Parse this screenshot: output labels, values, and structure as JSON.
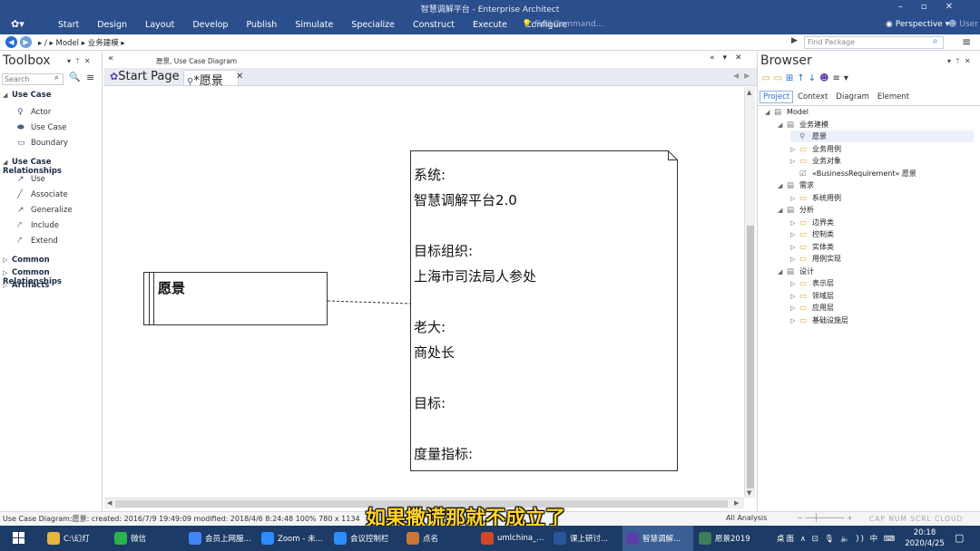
{
  "window": {
    "title": "智慧调解平台 - Enterprise Architect"
  },
  "menu": [
    "Start",
    "Design",
    "Layout",
    "Develop",
    "Publish",
    "Simulate",
    "Specialize",
    "Construct",
    "Execute",
    "Configure"
  ],
  "find_command": "Find Command...",
  "perspective": "Perspective",
  "user": "User",
  "nav": {
    "path_root": "/",
    "path_model": "Model",
    "path_pkg": "业务建模",
    "find_package_placeholder": "Find Package"
  },
  "toolbox": {
    "title": "Toolbox",
    "search_placeholder": "Search",
    "categories": [
      {
        "label": "Use Case",
        "items": [
          "Actor",
          "Use Case",
          "Boundary"
        ]
      },
      {
        "label": "Use Case Relationships",
        "items": [
          "Use",
          "Associate",
          "Generalize",
          "Include",
          "Extend"
        ]
      },
      {
        "label": "Common",
        "items": []
      },
      {
        "label": "Common Relationships",
        "items": []
      },
      {
        "label": "Artifacts",
        "items": []
      }
    ]
  },
  "diagram": {
    "caption": "愿景,",
    "caption_type": "Use Case Diagram",
    "tabs": [
      {
        "label": "Start Page"
      },
      {
        "label": "*愿景"
      }
    ],
    "requirement_label": "愿景",
    "note_lines": [
      "系统:",
      "智慧调解平台2.0",
      "",
      "目标组织:",
      "上海市司法局人参处",
      "",
      "老大:",
      "商处长",
      "",
      "目标:",
      "",
      "度量指标:"
    ]
  },
  "browser": {
    "title": "Browser",
    "tabs": [
      "Project",
      "Context",
      "Diagram",
      "Element"
    ],
    "active_tab": "Project",
    "tree": [
      {
        "label": "Model",
        "depth": 0,
        "icon": "model",
        "expanded": true
      },
      {
        "label": "业务建模",
        "depth": 1,
        "icon": "package",
        "expanded": true
      },
      {
        "label": "愿景",
        "depth": 2,
        "icon": "diagram",
        "leaf": true,
        "selected": true
      },
      {
        "label": "业务用例",
        "depth": 2,
        "icon": "folder"
      },
      {
        "label": "业务对象",
        "depth": 2,
        "icon": "folder"
      },
      {
        "label": "«BusinessRequirement» 愿景",
        "depth": 2,
        "icon": "requirement",
        "leaf": true
      },
      {
        "label": "需求",
        "depth": 1,
        "icon": "package",
        "expanded": true
      },
      {
        "label": "系统用例",
        "depth": 2,
        "icon": "folder"
      },
      {
        "label": "分析",
        "depth": 1,
        "icon": "package",
        "expanded": true
      },
      {
        "label": "边界类",
        "depth": 2,
        "icon": "folder"
      },
      {
        "label": "控制类",
        "depth": 2,
        "icon": "folder"
      },
      {
        "label": "实体类",
        "depth": 2,
        "icon": "folder"
      },
      {
        "label": "用例实现",
        "depth": 2,
        "icon": "folder"
      },
      {
        "label": "设计",
        "depth": 1,
        "icon": "package",
        "expanded": true
      },
      {
        "label": "表示层",
        "depth": 2,
        "icon": "folder"
      },
      {
        "label": "领域层",
        "depth": 2,
        "icon": "folder"
      },
      {
        "label": "应用层",
        "depth": 2,
        "icon": "folder"
      },
      {
        "label": "基础设施层",
        "depth": 2,
        "icon": "folder"
      }
    ]
  },
  "status": {
    "text": "Use Case Diagram:愿景:   created: 2016/7/9 19:49:09  modified: 2018/4/6 8:24:48   100%   780 x 1134",
    "analysis": "All Analysis",
    "zoom_minus": "−",
    "zoom_plus": "+",
    "keys": "CAP   NUM   SCRL   CLOUD"
  },
  "subtitle_overlay": "如果撒谎那就不成立了",
  "taskbar": {
    "tasks": [
      {
        "label": "C:\\幻灯",
        "icon_color": "#e8b640"
      },
      {
        "label": "微信",
        "icon_color": "#2bb24c"
      },
      {
        "label": "会员上网服...",
        "icon_color": "#4285f4"
      },
      {
        "label": "Zoom - 未...",
        "icon_color": "#2d8cff"
      },
      {
        "label": "会议控制栏",
        "icon_color": "#2d8cff"
      },
      {
        "label": "点名",
        "icon_color": "#c9763a"
      },
      {
        "label": "umlchina_...",
        "icon_color": "#d24726"
      },
      {
        "label": "课上研讨...",
        "icon_color": "#2b579a"
      },
      {
        "label": "智慧调解...",
        "icon_color": "#5b3fa8"
      },
      {
        "label": "愿景2019",
        "icon_color": "#3f7d5a"
      }
    ],
    "tray_desktop": "桌面",
    "tray_lang": "中",
    "clock_time": "20:18",
    "clock_date": "2020/4/25"
  },
  "colors": {
    "titlebar": "#2b4e8c",
    "taskbar": "#1c3b66",
    "subtitle": "#ffd42a",
    "accent": "#1f6fcf"
  }
}
